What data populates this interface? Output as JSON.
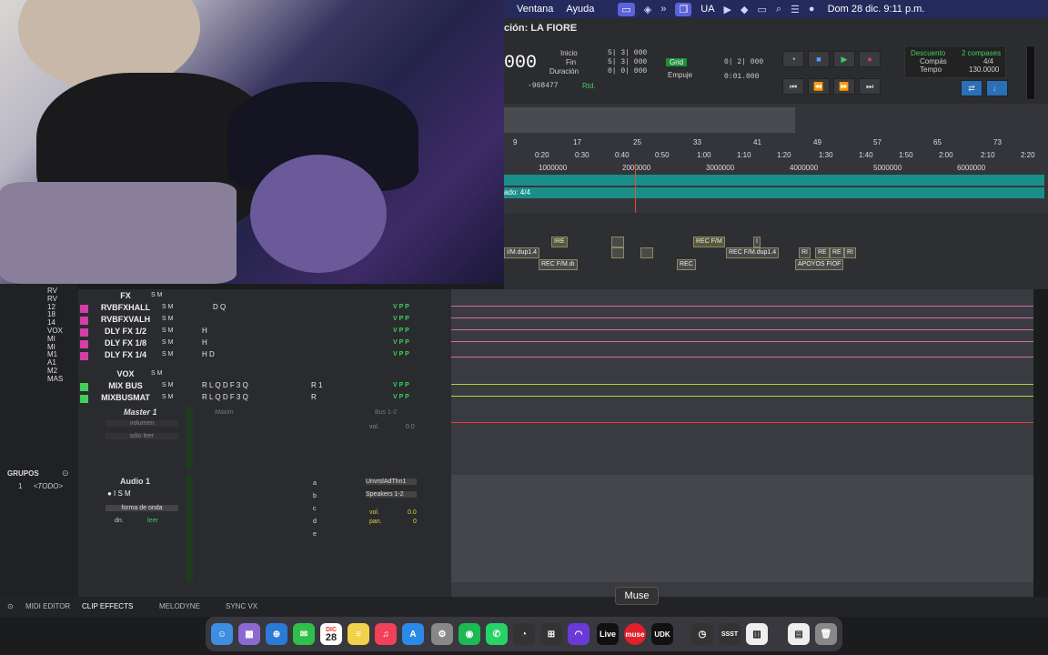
{
  "menubar": {
    "items": [
      "Ventana",
      "Ayuda"
    ],
    "lang": "UA",
    "clock": "Dom 28 dic.  9:11 p.m."
  },
  "session": {
    "title": "ción: LA FIORE"
  },
  "counter": {
    "main": "000",
    "inicio_label": "Inicio",
    "fin_label": "Fin",
    "duracion_label": "Duración",
    "inicio": "5| 3| 000",
    "fin": "5| 3| 000",
    "duracion": "0| 0| 000",
    "nudge_value": "-968477",
    "rtd": "Rtd."
  },
  "grid": {
    "label": "Grid",
    "value": "0| 2| 000",
    "empuje_label": "Empuje",
    "empuje_value": "0:01.000"
  },
  "countoff": {
    "descuento": "Descuento",
    "compases": "2 compases",
    "compas_label": "Compás",
    "compas_value": "4/4",
    "tempo_label": "Tempo",
    "tempo_value": "130.0000"
  },
  "ruler_bars": [
    "9",
    "17",
    "25",
    "33",
    "41",
    "49",
    "57",
    "65",
    "73"
  ],
  "ruler_times": [
    "0:20",
    "0:30",
    "0:40",
    "0:50",
    "1:00",
    "1:10",
    "1:20",
    "1:30",
    "1:40",
    "1:50",
    "2:00",
    "2:10",
    "2:20"
  ],
  "ruler_samples": [
    "1000000",
    "2000000",
    "3000000",
    "4000000",
    "5000000",
    "6000000"
  ],
  "meter_row": "ado: 4/4",
  "clips_row1": [
    "IRE",
    "REC F/M",
    "I"
  ],
  "clips_row2": [
    "I/M.dup1.4",
    "REC F/M.dup1.4",
    "RI",
    "RE",
    "RE",
    "RI"
  ],
  "clips_row3": [
    "REC F/M.dı",
    "REC",
    "APOYOS FIOF"
  ],
  "left_tracks": [
    "RV",
    "RV",
    "12",
    "18",
    "14",
    "VOX",
    "MI",
    "MI",
    "M1",
    "A1",
    "M2",
    "MAS"
  ],
  "groups": {
    "title": "GRUPOS",
    "item_num": "1",
    "item_name": "<TODO>"
  },
  "mixer": {
    "fx_folder": "FX",
    "vox_folder": "VOX",
    "fx_tracks": [
      {
        "name": "RVBFXHALL",
        "ins": "D  Q"
      },
      {
        "name": "RVBFXVALH",
        "ins": ""
      },
      {
        "name": "DLY FX 1/2",
        "ins": "H"
      },
      {
        "name": "DLY FX 1/8",
        "ins": "H"
      },
      {
        "name": "DLY FX 1/4",
        "ins": "H  D"
      }
    ],
    "vox_tracks": [
      {
        "name": "MIX BUS",
        "ins": "R  L  Q  D  F    3  Q",
        "send": "R 1"
      },
      {
        "name": "MIXBUSMAT",
        "ins": "R  L  Q  D  F    3  Q",
        "send": "R"
      }
    ],
    "master": {
      "name": "Master 1",
      "vol_mode": "volumen",
      "auto": "sólo leer",
      "maxim": "Maxim",
      "bus": "Bus 1-2",
      "vol_label": "vol.",
      "vol_value": "0.0"
    },
    "audio1": {
      "name": "Audio 1",
      "view": "forma de onda",
      "dyn": "dn.",
      "auto": "leer",
      "inputs": [
        "a",
        "b",
        "c",
        "d",
        "e"
      ],
      "in_sel": "UnvrslAdThn1",
      "out_sel": "Speakers 1-2",
      "vol_label": "vol.",
      "vol_value": "0.0",
      "pan_label": "pan.",
      "pan_value": "0"
    }
  },
  "bottom_tabs": [
    "MIDI EDITOR",
    "CLIP EFFECTS",
    "MELODYNE",
    "SYNC VX"
  ],
  "tooltip": "Muse",
  "dock": {
    "calendar_month": "DIC",
    "calendar_day": "28",
    "live": "Live",
    "muse": "muse",
    "udk": "UDK",
    "messages_badge": "2",
    "settings_badge": "1"
  },
  "colors": {
    "accent_green": "#1f8f3c",
    "track_pink": "#d53ea8",
    "track_green": "#3fcf5a",
    "teal_ruler": "#1a8f8a",
    "playhead": "#e0502a"
  }
}
